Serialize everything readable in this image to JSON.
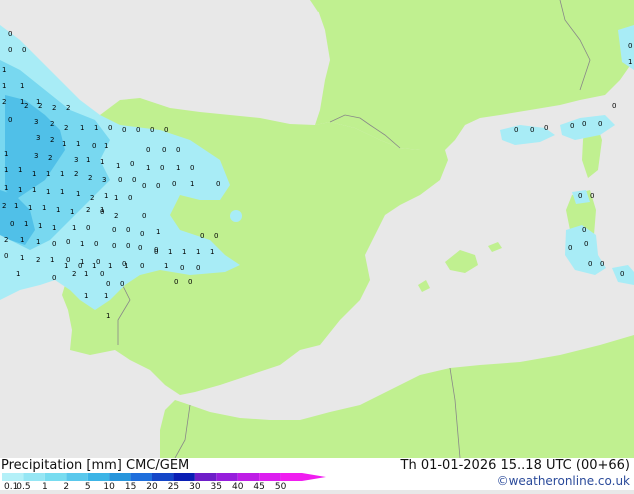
{
  "footer": {
    "title_left": "Precipitation [mm]  CMC/GEM",
    "title_right": "Th 01-01-2026 15..18 UTC (00+66)",
    "credit": "©weatheronline.co.uk"
  },
  "legend": {
    "ticks": [
      "0.1",
      "0.5",
      "1",
      "2",
      "5",
      "10",
      "15",
      "20",
      "25",
      "30",
      "35",
      "40",
      "45",
      "50"
    ],
    "colors": [
      "#b4f0f8",
      "#96e6f4",
      "#78dcf0",
      "#5ac8ec",
      "#3cb4e6",
      "#2896dc",
      "#1e6edc",
      "#1446c8",
      "#0a1eb4",
      "#6e1ec8",
      "#961edc",
      "#be1ee6",
      "#dc1ef0",
      "#f01ef0"
    ]
  },
  "map": {
    "land_color": "#c0f090",
    "sea_color": "#e8e8e8",
    "border_color": "#888888",
    "precip_light": "#a8ecf6",
    "precip_mid": "#78d8f0",
    "precip_heavy": "#50c0e8",
    "labels": [
      {
        "t": "0"
      },
      {
        "t": "0"
      },
      {
        "t": "0"
      },
      {
        "t": "1"
      },
      {
        "t": "1"
      },
      {
        "t": "1"
      },
      {
        "t": "2"
      },
      {
        "t": "1"
      },
      {
        "t": "1"
      },
      {
        "t": "2"
      },
      {
        "t": "2"
      },
      {
        "t": "2"
      },
      {
        "t": "2"
      },
      {
        "t": "3"
      },
      {
        "t": "2"
      },
      {
        "t": "0"
      },
      {
        "t": "3"
      },
      {
        "t": "2"
      },
      {
        "t": "2"
      },
      {
        "t": "1"
      },
      {
        "t": "1"
      },
      {
        "t": "0"
      },
      {
        "t": "0"
      },
      {
        "t": "0"
      },
      {
        "t": "0"
      },
      {
        "t": "0"
      },
      {
        "t": "1"
      },
      {
        "t": "3"
      },
      {
        "t": "2"
      },
      {
        "t": "1"
      },
      {
        "t": "1"
      },
      {
        "t": "0"
      },
      {
        "t": "1"
      },
      {
        "t": "3"
      },
      {
        "t": "1"
      },
      {
        "t": "1"
      },
      {
        "t": "2"
      },
      {
        "t": "3"
      },
      {
        "t": "1"
      },
      {
        "t": "0"
      },
      {
        "t": "0"
      },
      {
        "t": "0"
      },
      {
        "t": "0"
      },
      {
        "t": "1"
      },
      {
        "t": "1"
      },
      {
        "t": "1"
      },
      {
        "t": "1"
      },
      {
        "t": "1"
      },
      {
        "t": "2"
      },
      {
        "t": "2"
      },
      {
        "t": "1"
      },
      {
        "t": "0"
      },
      {
        "t": "0"
      },
      {
        "t": "1"
      },
      {
        "t": "0"
      },
      {
        "t": "1"
      },
      {
        "t": "0"
      },
      {
        "t": "1"
      },
      {
        "t": "1"
      },
      {
        "t": "1"
      },
      {
        "t": "1"
      },
      {
        "t": "1"
      },
      {
        "t": "1"
      },
      {
        "t": "2"
      },
      {
        "t": "1"
      },
      {
        "t": "1"
      },
      {
        "t": "0"
      },
      {
        "t": "0"
      },
      {
        "t": "0"
      },
      {
        "t": "0"
      },
      {
        "t": "1"
      },
      {
        "t": "2"
      },
      {
        "t": "1"
      },
      {
        "t": "1"
      },
      {
        "t": "1"
      },
      {
        "t": "1"
      },
      {
        "t": "1"
      },
      {
        "t": "1"
      },
      {
        "t": "0"
      },
      {
        "t": "0"
      },
      {
        "t": "2"
      },
      {
        "t": "0"
      },
      {
        "t": "1"
      },
      {
        "t": "1"
      },
      {
        "t": "1"
      },
      {
        "t": "0"
      },
      {
        "t": "1"
      },
      {
        "t": "0"
      },
      {
        "t": "0"
      },
      {
        "t": "0"
      },
      {
        "t": "0"
      },
      {
        "t": "2"
      },
      {
        "t": "1"
      },
      {
        "t": "1"
      },
      {
        "t": "0"
      },
      {
        "t": "0"
      },
      {
        "t": "1"
      },
      {
        "t": "0"
      },
      {
        "t": "0"
      },
      {
        "t": "0"
      },
      {
        "t": "0"
      },
      {
        "t": "1"
      },
      {
        "t": "0"
      },
      {
        "t": "1"
      },
      {
        "t": "2"
      },
      {
        "t": "1"
      },
      {
        "t": "1"
      },
      {
        "t": "0"
      },
      {
        "t": "1"
      },
      {
        "t": "1"
      },
      {
        "t": "0"
      },
      {
        "t": "0"
      },
      {
        "t": "0"
      },
      {
        "t": "1"
      },
      {
        "t": "0"
      },
      {
        "t": "2"
      },
      {
        "t": "1"
      },
      {
        "t": "0"
      },
      {
        "t": "1"
      },
      {
        "t": "0"
      },
      {
        "t": "0"
      },
      {
        "t": "1"
      },
      {
        "t": "1"
      },
      {
        "t": "1"
      },
      {
        "t": "1"
      },
      {
        "t": "1"
      },
      {
        "t": "0"
      },
      {
        "t": "0"
      },
      {
        "t": "1"
      },
      {
        "t": "1"
      },
      {
        "t": "0"
      },
      {
        "t": "0"
      },
      {
        "t": "1"
      },
      {
        "t": "0"
      },
      {
        "t": "0"
      },
      {
        "t": "0"
      },
      {
        "t": "0"
      },
      {
        "t": "0"
      },
      {
        "t": "0"
      },
      {
        "t": "0"
      },
      {
        "t": "0"
      },
      {
        "t": "0"
      },
      {
        "t": "0"
      },
      {
        "t": "0"
      },
      {
        "t": "0"
      },
      {
        "t": "0"
      },
      {
        "t": "1"
      },
      {
        "t": "0"
      },
      {
        "t": "0"
      },
      {
        "t": "0"
      },
      {
        "t": "0"
      },
      {
        "t": "0"
      },
      {
        "t": "0"
      },
      {
        "t": "0"
      },
      {
        "t": "0"
      }
    ]
  }
}
